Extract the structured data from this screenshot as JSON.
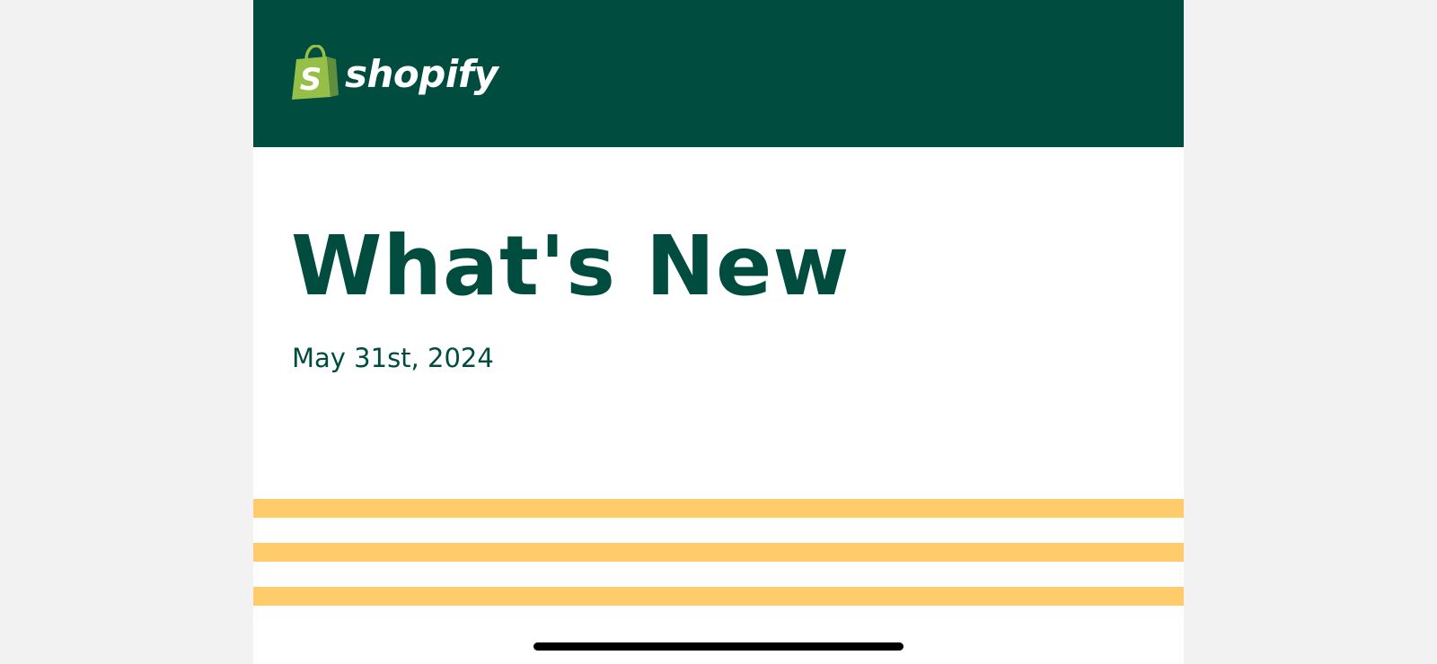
{
  "brand": {
    "name": "shopify",
    "header_color": "#004c3f",
    "logo_green": "#95bf47",
    "logo_icon": "shopping-bag-icon"
  },
  "content": {
    "title": "What's New",
    "date": "May 31st, 2024",
    "text_color": "#004c3f"
  },
  "decoration": {
    "stripe_color": "#ffcb6b"
  }
}
